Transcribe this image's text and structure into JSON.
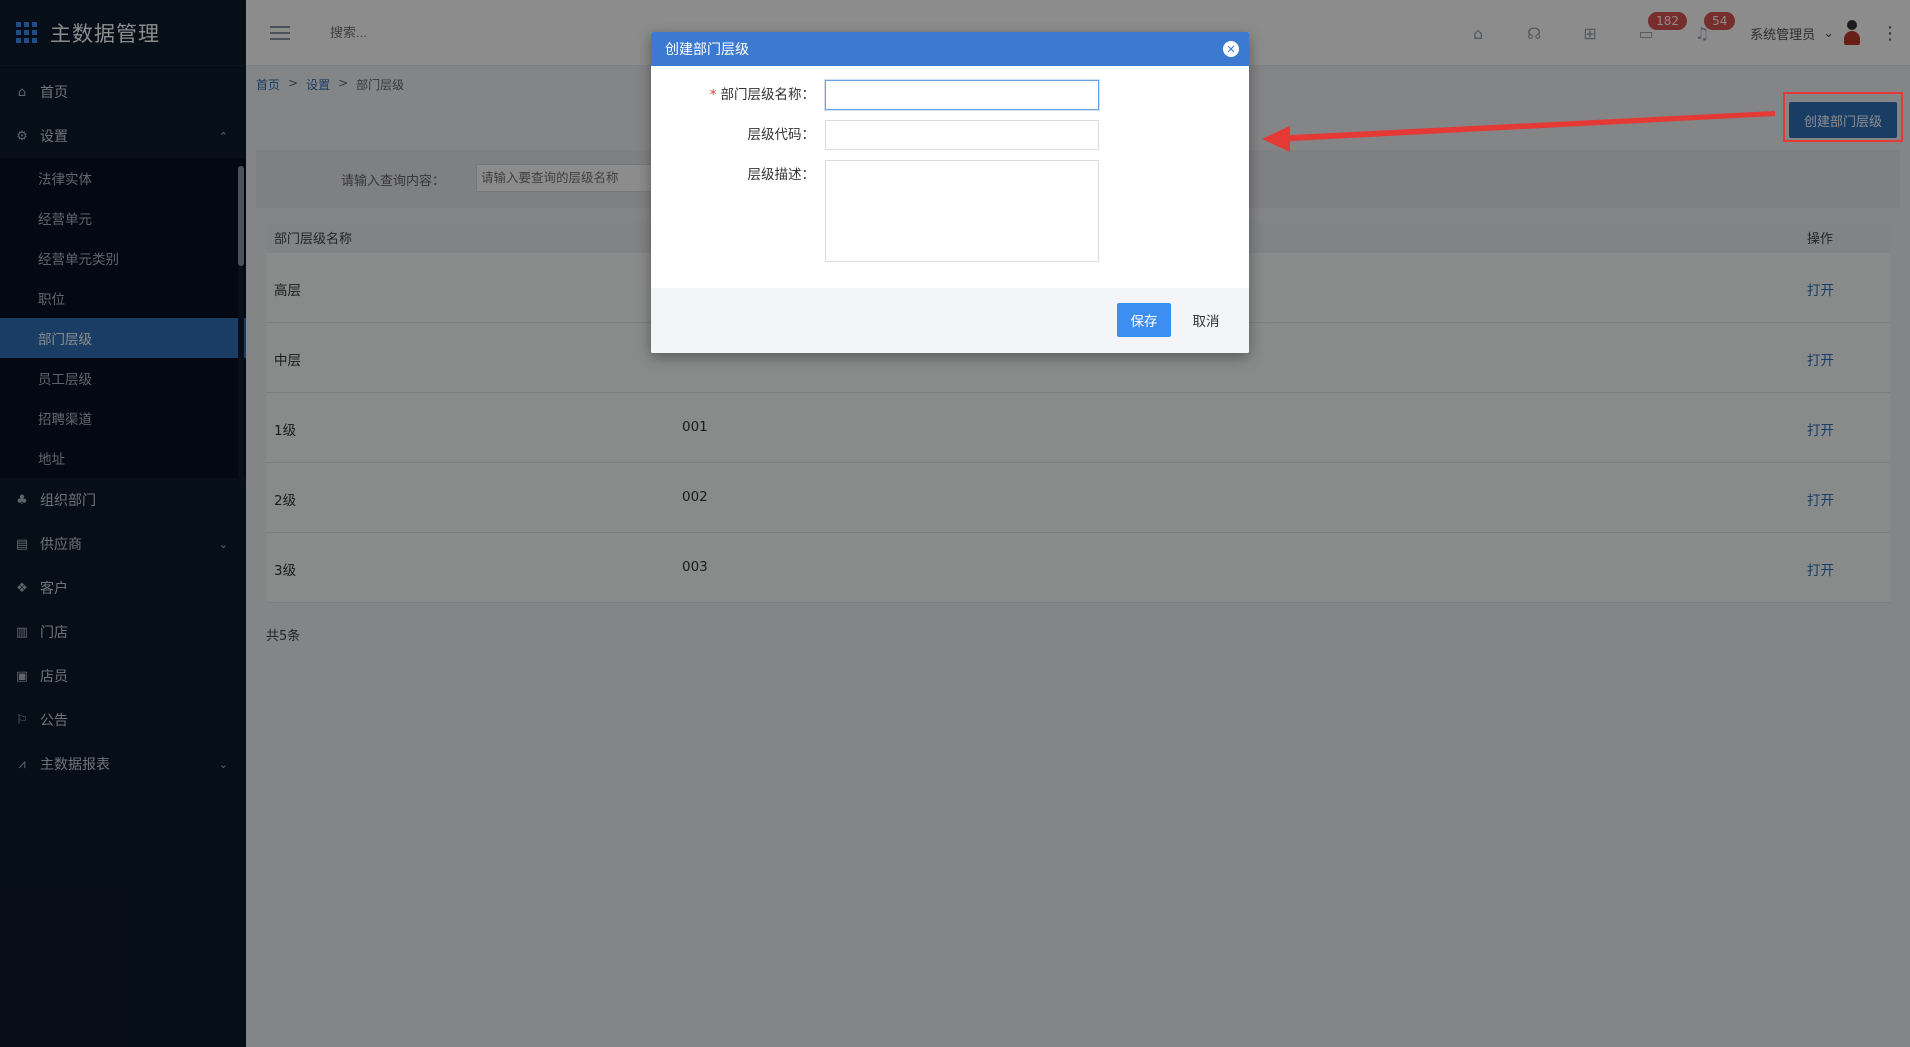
{
  "app": {
    "title": "主数据管理"
  },
  "sidebar": {
    "items": [
      {
        "label": "首页",
        "icon": "home-icon"
      },
      {
        "label": "设置",
        "icon": "gear-icon",
        "expanded": true
      },
      {
        "label": "组织部门",
        "icon": "org-icon"
      },
      {
        "label": "供应商",
        "icon": "supplier-icon",
        "has_children": true
      },
      {
        "label": "客户",
        "icon": "customer-icon"
      },
      {
        "label": "门店",
        "icon": "store-icon"
      },
      {
        "label": "店员",
        "icon": "clerk-icon"
      },
      {
        "label": "公告",
        "icon": "announcement-icon"
      },
      {
        "label": "主数据报表",
        "icon": "chart-icon",
        "has_children": true
      }
    ],
    "settings_sub": [
      {
        "label": "法律实体"
      },
      {
        "label": "经营单元"
      },
      {
        "label": "经营单元类别"
      },
      {
        "label": "职位"
      },
      {
        "label": "部门层级",
        "active": true
      },
      {
        "label": "员工层级"
      },
      {
        "label": "招聘渠道"
      },
      {
        "label": "地址"
      }
    ]
  },
  "topbar": {
    "search_placeholder": "搜索...",
    "badge_messages": "182",
    "badge_notifications": "54",
    "user_name": "系统管理员"
  },
  "breadcrumb": {
    "home": "首页",
    "sep1": ">",
    "settings": "设置",
    "sep2": ">",
    "current": "部门层级"
  },
  "page": {
    "create_button_label": "创建部门层级"
  },
  "filter": {
    "label": "请输入查询内容：",
    "placeholder": "请输入要查询的层级名称"
  },
  "table": {
    "headers": {
      "name": "部门层级名称",
      "action": "操作"
    },
    "rows": [
      {
        "name": "高层",
        "code": "",
        "action": "打开"
      },
      {
        "name": "中层",
        "code": "",
        "action": "打开"
      },
      {
        "name": "1级",
        "code": "001",
        "action": "打开"
      },
      {
        "name": "2级",
        "code": "002",
        "action": "打开"
      },
      {
        "name": "3级",
        "code": "003",
        "action": "打开"
      }
    ],
    "total": "共5条"
  },
  "modal": {
    "title": "创建部门层级",
    "fields": {
      "name_label": "部门层级名称：",
      "name_required_mark": "*",
      "name_value": "",
      "code_label": "层级代码：",
      "code_value": "",
      "desc_label": "层级描述：",
      "desc_value": ""
    },
    "save_label": "保存",
    "cancel_label": "取消"
  },
  "colors": {
    "sidebar_bg": "#0c1a2c",
    "accent": "#2f6fb9",
    "modal_header": "#3c7ad1",
    "annotation_red": "#e53935"
  }
}
